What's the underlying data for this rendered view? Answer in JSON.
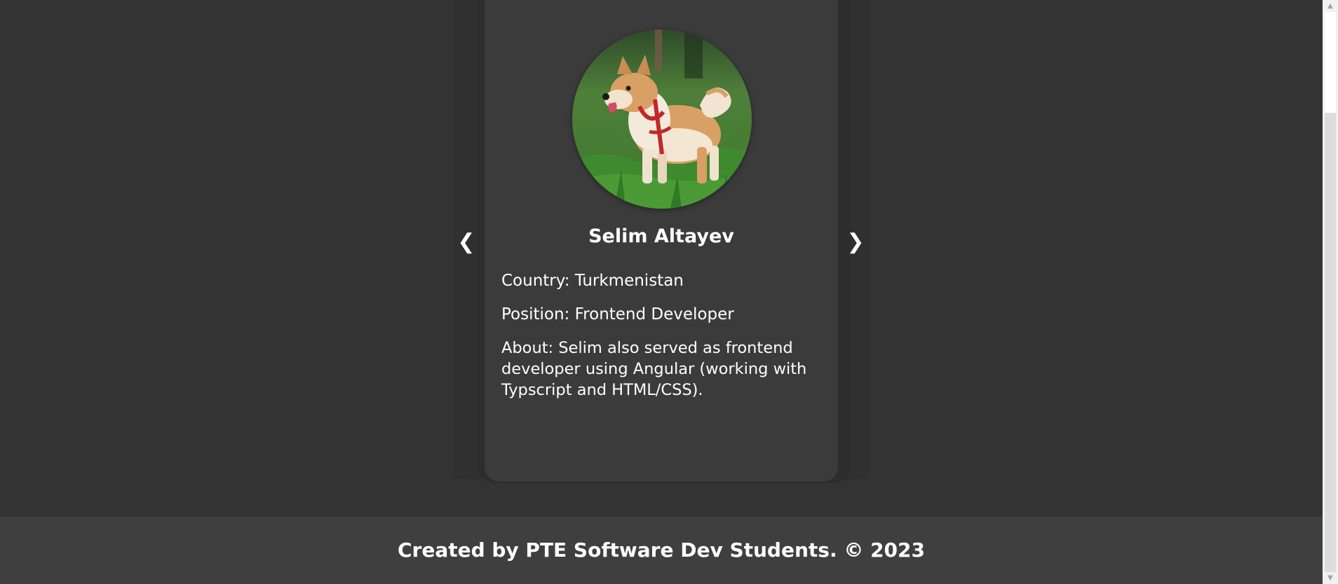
{
  "carousel": {
    "prev_label": "❮",
    "next_label": "❯"
  },
  "member": {
    "name": "Selim Altayev",
    "country": "Country: Turkmenistan",
    "position": "Position: Frontend Developer",
    "about": "About: Selim also served as frontend developer using Angular (working with Typscript and HTML/CSS).",
    "photo_icon": "shiba-inu-dog-photo"
  },
  "footer": {
    "text": "Created by PTE Software Dev Students. © 2023"
  },
  "scrollbar": {
    "up_label": "▲",
    "down_label": "▼"
  },
  "colors": {
    "page_background": "#333333",
    "card_background": "#3b3b3b",
    "footer_background": "#3f3f3f",
    "text": "#ffffff"
  }
}
